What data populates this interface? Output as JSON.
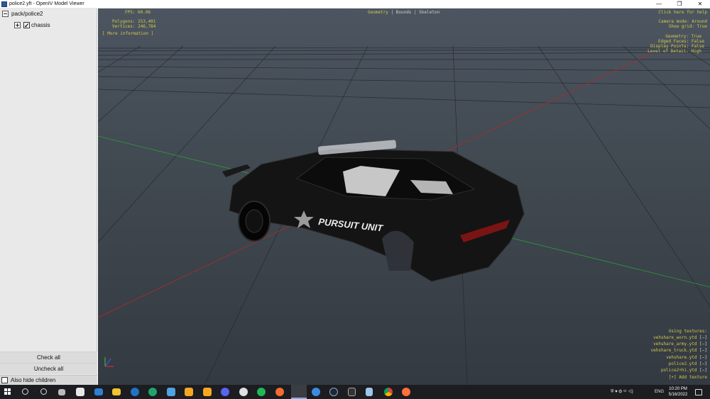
{
  "window": {
    "title": "police2.yft - OpenIV Model Viewer",
    "minimize": "—",
    "maximize": "❐",
    "close": "✕"
  },
  "tree": {
    "root": "pack/police2",
    "child": "chassis",
    "child_checked": "✓"
  },
  "panel": {
    "check_all": "Check all",
    "uncheck_all": "Uncheck all",
    "also_hide_children": "Also hide children"
  },
  "viewport": {
    "tabs": {
      "geometry": "Geometry",
      "sep1": " | ",
      "bounds": "Bounds",
      "sep2": " | ",
      "skeleton": "Skeleton"
    },
    "fps": "FPS: 60.06",
    "polygons": "Polygons: 253,401",
    "vertices": "Vertices: 246,784",
    "more_info": "[ More information ]",
    "help": "Click here for help",
    "camera_mode": "Camera mode: Around",
    "show_grid": "Show grid: True",
    "geometry": "Geometry: True",
    "edged_faces": "Edged Faces: False",
    "display_points": "Display Points: False",
    "level_of_detail": "Level of Detail: High",
    "using_textures": "Using textures:",
    "textures": [
      {
        "name": "vehshare_worn.ytd",
        "mark": "[−]"
      },
      {
        "name": "vehshare_army.ytd",
        "mark": "[−]"
      },
      {
        "name": "vehshare_truck.ytd",
        "mark": "[−]"
      },
      {
        "name": "vehshare.ytd",
        "mark": "[−]"
      },
      {
        "name": "police2.ytd",
        "mark": "[−]"
      },
      {
        "name": "police2+hi.ytd",
        "mark": "[−]"
      }
    ],
    "add_texture": "[+] Add texture",
    "car_decal": "PURSUIT UNIT"
  },
  "taskbar": {
    "lang": "ENG",
    "time": "10:20 PM",
    "date": "5/16/2022",
    "icons": [
      "start-icon",
      "search-icon",
      "cortana-icon",
      "task-view-icon",
      "store-icon",
      "mail-icon",
      "file-explorer-icon",
      "edge-legacy-icon",
      "edge-icon",
      "photos-icon",
      "rockstar-icon",
      "rockstar-games-launcher-icon",
      "discord-icon",
      "obs-icon",
      "spotify-icon",
      "origin-icon",
      "openiv-icon",
      "media-icon",
      "steam-icon",
      "epic-games-icon",
      "notepad-icon",
      "chrome-icon",
      "firefox-icon"
    ]
  },
  "colors": {
    "hud_yellow": "#d4c84a",
    "hud_green": "#59d06a",
    "viewport_bg": "#404850",
    "taskbar": "#1b1d21"
  }
}
